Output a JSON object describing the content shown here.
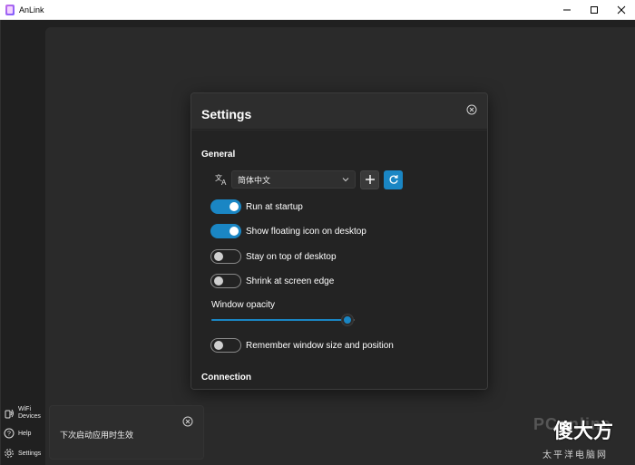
{
  "window": {
    "title": "AnLink",
    "controls": [
      "minimize-icon",
      "maximize-icon",
      "close-icon"
    ]
  },
  "sidebar": {
    "items": [
      {
        "label": "WiFi Devices",
        "icon": "wifi-device-icon"
      },
      {
        "label": "Help",
        "icon": "help-icon"
      },
      {
        "label": "Settings",
        "icon": "gear-icon"
      }
    ]
  },
  "settings": {
    "title": "Settings",
    "general_title": "General",
    "language": {
      "selected": "简体中文",
      "icon": "translate-icon"
    },
    "toggles": [
      {
        "label": "Run at startup",
        "on": true
      },
      {
        "label": "Show floating icon on desktop",
        "on": true
      },
      {
        "label": "Stay on top of desktop",
        "on": false
      },
      {
        "label": "Shrink at screen edge",
        "on": false
      }
    ],
    "opacity": {
      "label": "Window opacity",
      "value_fraction": 0.95
    },
    "remember_toggle": {
      "label": "Remember window size and position",
      "on": false
    },
    "connection_title": "Connection"
  },
  "toast": {
    "message": "下次启动应用时生效"
  },
  "watermark": {
    "big": "PConline",
    "cn": "傻大方",
    "sub": "太平洋电脑网"
  },
  "colors": {
    "accent": "#1a86c4",
    "background": "#202020",
    "dialog": "#2b2b2b"
  }
}
